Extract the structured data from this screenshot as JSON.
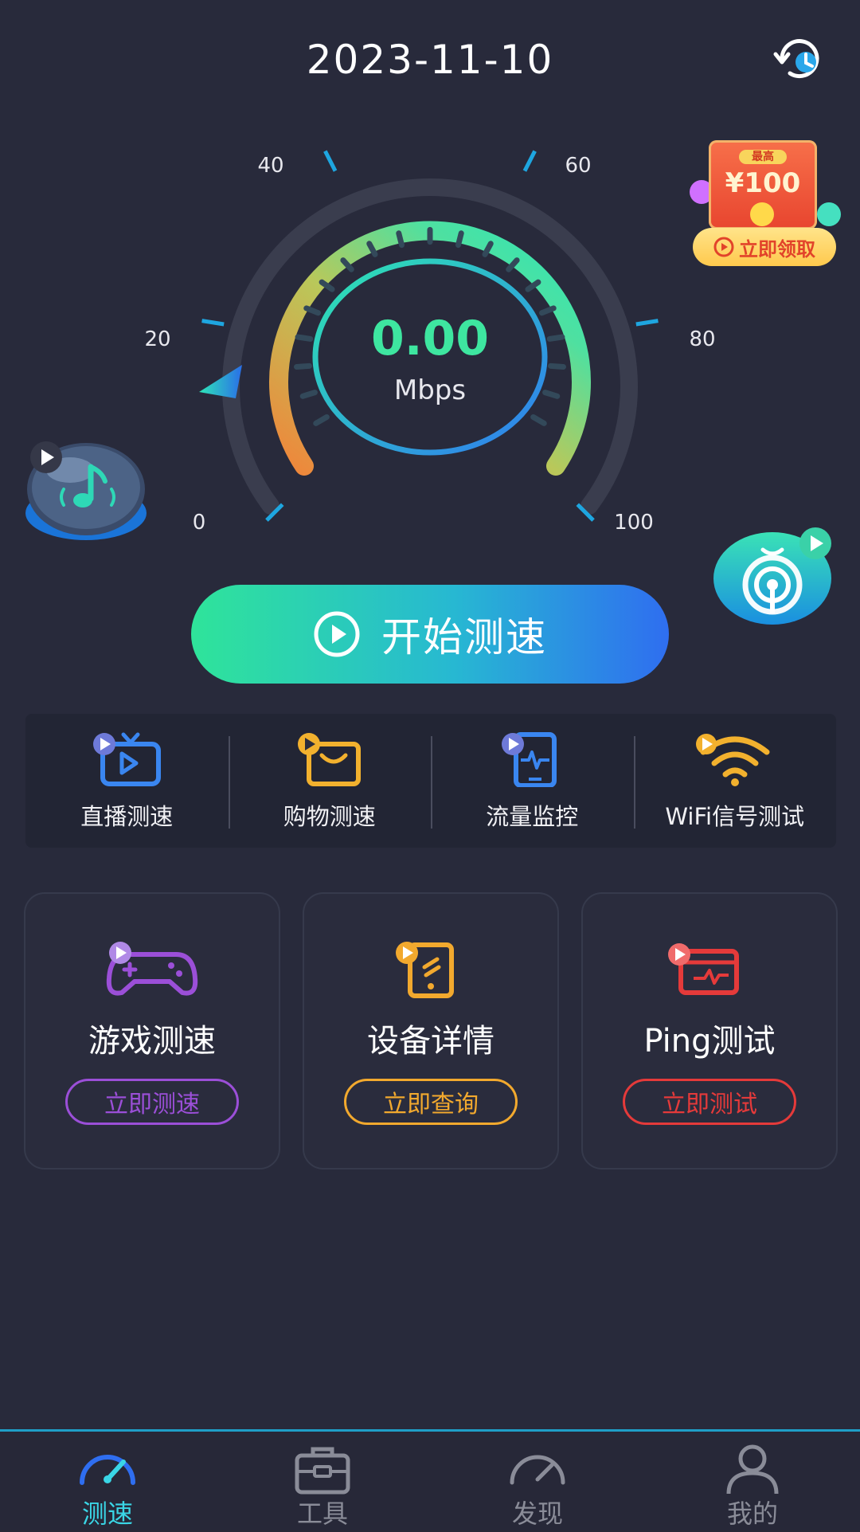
{
  "header": {
    "date": "2023-11-10",
    "history_icon": "history-icon"
  },
  "gauge": {
    "value": "0.00",
    "unit": "Mbps",
    "speed_mbps": 0,
    "ticks": [
      "0",
      "20",
      "40",
      "60",
      "80",
      "100"
    ],
    "colors": {
      "arc_start": "#f0853a",
      "arc_mid": "#8ad25a",
      "arc_end": "#2ee6b8",
      "value": "#3ee6a0"
    }
  },
  "promo": {
    "badge": "最高",
    "amount": "¥100",
    "button": "立即领取"
  },
  "start_button": {
    "label": "开始测速",
    "icon": "play-circle-icon"
  },
  "quick_tools": [
    {
      "label": "直播测速",
      "icon": "tv-icon"
    },
    {
      "label": "购物测速",
      "icon": "shopping-bag-icon"
    },
    {
      "label": "流量监控",
      "icon": "traffic-monitor-icon"
    },
    {
      "label": "WiFi信号测试",
      "icon": "wifi-icon"
    }
  ],
  "cards": [
    {
      "title": "游戏测速",
      "button": "立即测速",
      "icon": "gamepad-icon",
      "color": "#9b4fd8"
    },
    {
      "title": "设备详情",
      "button": "立即查询",
      "icon": "device-link-icon",
      "color": "#f2a92e"
    },
    {
      "title": "Ping测试",
      "button": "立即测试",
      "icon": "ping-window-icon",
      "color": "#e53a3a"
    }
  ],
  "nav": [
    {
      "label": "测速",
      "icon": "speedometer-icon",
      "active": true
    },
    {
      "label": "工具",
      "icon": "toolbox-icon",
      "active": false
    },
    {
      "label": "发现",
      "icon": "discover-gauge-icon",
      "active": false
    },
    {
      "label": "我的",
      "icon": "user-icon",
      "active": false
    }
  ],
  "accent_color": "#3ad6e6"
}
